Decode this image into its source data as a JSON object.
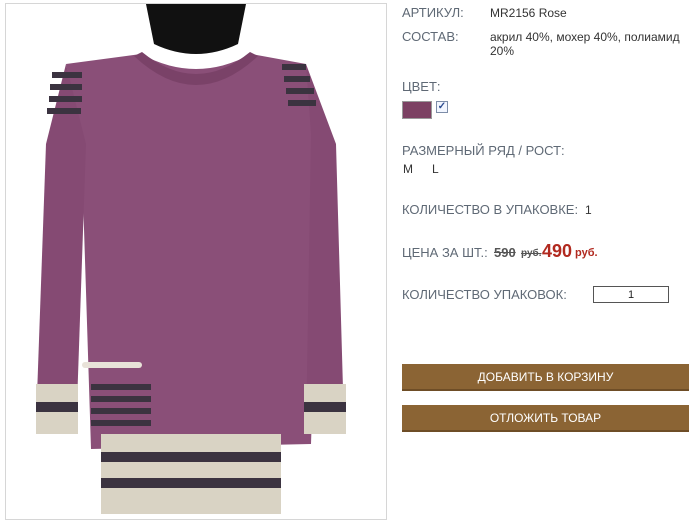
{
  "product": {
    "article_label": "АРТИКУЛ:",
    "article_value": "MR2156 Rose",
    "composition_label": "СОСТАВ:",
    "composition_value": "акрил 40%, мохер 40%, полиамид 20%",
    "color_label": "ЦВЕТ:",
    "colors": [
      {
        "name": "Rose",
        "hex": "#7c4163",
        "selected": true
      }
    ],
    "sizes_label": "РАЗМЕРНЫЙ РЯД / РОСТ:",
    "sizes": [
      "M",
      "L"
    ],
    "pack_label": "КОЛИЧЕСТВО В УПАКОВКЕ:",
    "pack_value": "1",
    "price_label": "ЦЕНА ЗА ШТ.:",
    "old_price": "590",
    "old_currency": "руб.",
    "new_price": "490",
    "new_currency": "руб.",
    "qty_label": "КОЛИЧЕСТВО УПАКОВОК:",
    "qty_value": "1"
  },
  "actions": {
    "add_to_cart": "ДОБАВИТЬ В КОРЗИНУ",
    "postpone": "ОТЛОЖИТЬ ТОВАР"
  },
  "image": {
    "subject": "sweater-photo",
    "main_color": "#8a4f78",
    "stripe_dark": "#3b3340",
    "stripe_light": "#d9d3c4"
  }
}
